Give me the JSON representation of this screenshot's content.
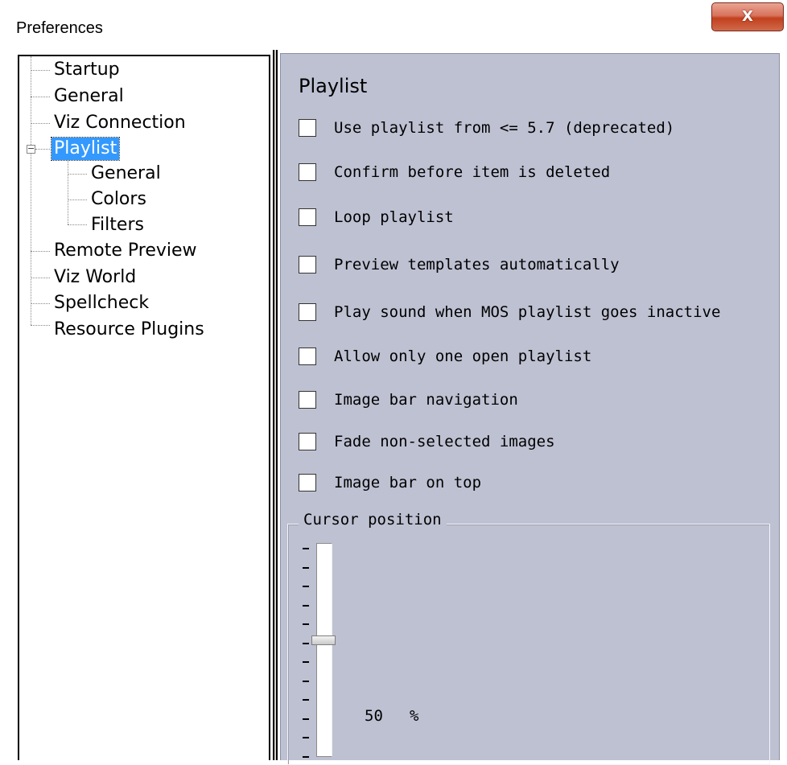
{
  "window": {
    "title": "Preferences",
    "close_label": "X"
  },
  "tree": {
    "items": [
      {
        "label": "Startup",
        "level": 0
      },
      {
        "label": "General",
        "level": 0
      },
      {
        "label": "Viz Connection",
        "level": 0
      },
      {
        "label": "Playlist",
        "level": 0,
        "expanded": true,
        "selected": true
      },
      {
        "label": "General",
        "level": 1
      },
      {
        "label": "Colors",
        "level": 1
      },
      {
        "label": "Filters",
        "level": 1
      },
      {
        "label": "Remote Preview",
        "level": 0
      },
      {
        "label": "Viz World",
        "level": 0
      },
      {
        "label": "Spellcheck",
        "level": 0
      },
      {
        "label": "Resource Plugins",
        "level": 0
      }
    ],
    "expander_symbol": "−"
  },
  "content": {
    "title": "Playlist",
    "options": [
      {
        "label": "Use playlist from <= 5.7 (deprecated)",
        "checked": false
      },
      {
        "label": "Confirm before item is deleted",
        "checked": false
      },
      {
        "label": "Loop playlist",
        "checked": false
      },
      {
        "label": "Preview templates automatically",
        "checked": false
      },
      {
        "label": "Play sound when MOS playlist goes inactive",
        "checked": false
      },
      {
        "label": "Allow only one open playlist",
        "checked": false
      },
      {
        "label": "Image bar navigation",
        "checked": false
      },
      {
        "label": "Fade non-selected images",
        "checked": false
      },
      {
        "label": "Image bar on top",
        "checked": false
      }
    ],
    "cursor_position": {
      "legend": "Cursor position",
      "value": "50",
      "unit": "%",
      "level_fraction": 0.5
    }
  },
  "colors": {
    "selection": "#3399ff",
    "panel_background": "#bec1d2",
    "close_button": "#c2401e"
  }
}
